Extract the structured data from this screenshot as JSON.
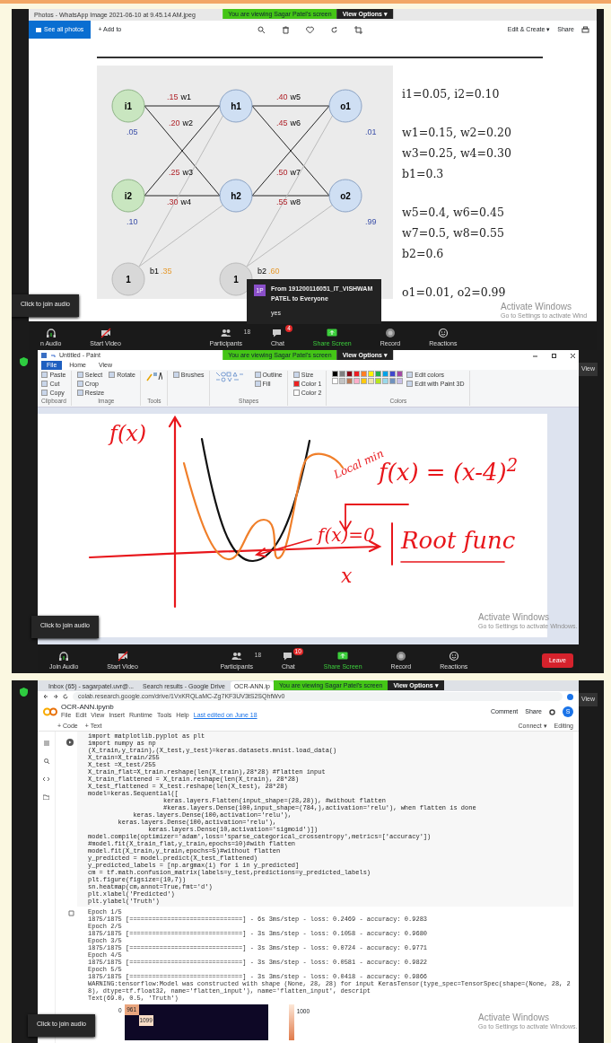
{
  "photos_share": {
    "viewing_banner": "You are viewing Sagar Patel's screen",
    "view_options": "View Options ▾",
    "window_title": "Photos - WhatsApp Image 2021-06-10 at 9.45.14 AM.jpeg",
    "see_all": "See all photos",
    "add_to": "+ Add to",
    "edit_create": "Edit & Create ▾",
    "share": "Share",
    "diagram": {
      "inputs": [
        {
          "label": "i1",
          "value": ".05"
        },
        {
          "label": "i2",
          "value": ".10"
        }
      ],
      "hidden": [
        {
          "label": "h1"
        },
        {
          "label": "h2"
        }
      ],
      "outputs": [
        {
          "label": "o1",
          "value": ".01"
        },
        {
          "label": "o2",
          "value": ".99"
        }
      ],
      "weights": [
        {
          "value": ".15",
          "name": "w1"
        },
        {
          "value": ".20",
          "name": "w2"
        },
        {
          "value": ".25",
          "name": "w3"
        },
        {
          "value": ".30",
          "name": "w4"
        },
        {
          "value": ".40",
          "name": "w5"
        },
        {
          "value": ".45",
          "name": "w6"
        },
        {
          "value": ".50",
          "name": "w7"
        },
        {
          "value": ".55",
          "name": "w8"
        }
      ],
      "biases": [
        {
          "node": "1",
          "name": "b1",
          "value": ".35"
        },
        {
          "node": "1",
          "name": "b2",
          "value": ".60"
        }
      ]
    },
    "equation_groups": [
      [
        "i1=0.05, i2=0.10"
      ],
      [
        "w1=0.15, w2=0.20",
        "w3=0.25, w4=0.30",
        "b1=0.3"
      ],
      [
        "w5=0.4, w6=0.45",
        "w7=0.5, w8=0.55",
        "b2=0.6"
      ],
      [
        "o1=0.01, o2=0.99"
      ]
    ],
    "chat_popup": {
      "avatar": "1P",
      "from": "From 191200116051_IT_VISHWAM PATEL to Everyone",
      "message": "yes"
    },
    "audio_tooltip": "Click to join audio",
    "activate": {
      "title": "Activate Windows",
      "hint": "Go to Settings to activate Wind"
    },
    "toolbar": [
      {
        "kind": "audio",
        "label": "n Audio"
      },
      {
        "kind": "video",
        "label": "Start Video"
      },
      {
        "kind": "participants",
        "label": "Participants",
        "count": "18"
      },
      {
        "kind": "chat",
        "label": "Chat",
        "badge": "4"
      },
      {
        "kind": "share",
        "label": "Share Screen"
      },
      {
        "kind": "record",
        "label": "Record"
      },
      {
        "kind": "reactions",
        "label": "Reactions"
      }
    ]
  },
  "paint_share": {
    "viewing_banner": "You are viewing Sagar Patel's screen",
    "view_options": "View Options ▾",
    "view_button": "View",
    "window_title": "Untitled - Paint",
    "tabs": [
      {
        "label": "File",
        "selected": true
      },
      {
        "label": "Home",
        "selected": false
      },
      {
        "label": "View",
        "selected": false
      }
    ],
    "groups": [
      {
        "label": "Clipboard",
        "tools": [
          "Paste",
          "Cut",
          "Copy"
        ]
      },
      {
        "label": "Image",
        "tools": [
          "Select",
          "Crop",
          "Resize",
          "Rotate"
        ]
      },
      {
        "label": "Tools"
      },
      {
        "tools": [
          "Brushes"
        ]
      },
      {
        "label": "Shapes",
        "tools": [
          "Outline",
          "Fill"
        ]
      },
      {
        "tools": [
          "Size",
          "Color 1",
          "Color 2"
        ]
      },
      {
        "label": "Colors",
        "tools": [
          "Edit colors",
          "Edit with Paint 3D"
        ]
      }
    ],
    "palette": [
      {
        "color": "#000000"
      },
      {
        "color": "#7f7f7f"
      },
      {
        "color": "#880015"
      },
      {
        "color": "#ed1c24"
      },
      {
        "color": "#ff7f27"
      },
      {
        "color": "#fff200"
      },
      {
        "color": "#22b14c"
      },
      {
        "color": "#00a2e8"
      },
      {
        "color": "#3f48cc"
      },
      {
        "color": "#a349a4"
      },
      {
        "color": "#ffffff"
      },
      {
        "color": "#c3c3c3"
      },
      {
        "color": "#b97a57"
      },
      {
        "color": "#ffaec9"
      },
      {
        "color": "#ffc90e"
      },
      {
        "color": "#efe4b0"
      },
      {
        "color": "#b5e61d"
      },
      {
        "color": "#99d9ea"
      },
      {
        "color": "#7092be"
      },
      {
        "color": "#c8bfe7"
      }
    ],
    "handwriting": {
      "y_label": "f(x)",
      "local_min": "Local min",
      "function": "f(x) = (x-4)$^{2}$",
      "root_eq": "f(x)=0",
      "root_label": "Root func",
      "x_label": "x"
    },
    "audio_tooltip": "Click to join audio",
    "activate": {
      "title": "Activate Windows",
      "hint": "Go to Settings to activate Windows."
    },
    "toolbar": [
      {
        "kind": "audio",
        "label": "Join Audio"
      },
      {
        "kind": "video",
        "label": "Start Video"
      },
      {
        "kind": "participants",
        "label": "Participants",
        "count": "18"
      },
      {
        "kind": "chat",
        "label": "Chat",
        "badge": "10"
      },
      {
        "kind": "share",
        "label": "Share Screen"
      },
      {
        "kind": "record",
        "label": "Record"
      },
      {
        "kind": "reactions",
        "label": "Reactions"
      },
      {
        "kind": "leave",
        "label": "Leave"
      }
    ]
  },
  "colab_share": {
    "viewing_banner": "You are viewing Sagar Patel's screen",
    "view_options": "View Options ▾",
    "view_button": "View",
    "browser_tabs": [
      {
        "label": "Inbox (65) - sagarpatel.uvr@...",
        "selected": false
      },
      {
        "label": "Search results - Google Drive",
        "selected": false
      },
      {
        "label": "OCR-ANN.ip",
        "selected": true
      }
    ],
    "url": "colab.research.google.com/drive/1VxKRQLaMC-Zg7KF3UV3tS2SQhfWv0",
    "notebook_title": "OCR-ANN.ipynb",
    "menu": [
      "File",
      "Edit",
      "View",
      "Insert",
      "Runtime",
      "Tools",
      "Help"
    ],
    "last_edited": "Last edited on June 18",
    "comment": "Comment",
    "share": "Share",
    "avatar": "S",
    "add_code": "+ Code",
    "add_text": "+ Text",
    "connect": "Connect ▾",
    "editing": "Editing",
    "code": [
      "import matplotlib.pyplot as plt",
      "import numpy as np",
      "(X_train,y_train),(X_test,y_test)=keras.datasets.mnist.load_data()",
      "X_train=X_train/255",
      "X_test =X_test/255",
      "X_train_flat=X_train.reshape(len(X_train),28*28) #flatten input",
      "X_train_flattened = X_train.reshape(len(X_train), 28*28)",
      "X_test_flattened = X_test.reshape(len(X_test), 28*28)",
      "model=keras.Sequential([",
      "                    keras.layers.Flatten(input_shape=(28,28)), #without flatten",
      "                    #keras.layers.Dense(100,input_shape=(784,),activation='relu'), when flatten is done",
      "            keras.layers.Dense(100,activation='relu'),",
      "        keras.layers.Dense(100,activation='relu'),",
      "                keras.layers.Dense(10,activation='sigmoid')])",
      "model.compile(optimizer='adam',loss='sparse_categorical_crossentropy',metrics=['accuracy'])",
      "#model.fit(X_train_flat,y_train,epochs=10)#with flatten",
      "model.fit(X_train,y_train,epochs=5)#without flatten",
      "y_predicted = model.predict(X_test_flattened)",
      "y_predicted_labels = [np.argmax(i) for i in y_predicted]",
      "cm = tf.math.confusion_matrix(labels=y_test,predictions=y_predicted_labels)",
      "plt.figure(figsize=(10,7))",
      "sn.heatmap(cm,annot=True,fmt='d')",
      "plt.xlabel('Predicted')",
      "plt.ylabel('Truth')"
    ],
    "output": [
      "Epoch 1/5",
      "1875/1875 [==============================] - 6s 3ms/step - loss: 0.2469 - accuracy: 0.9283",
      "Epoch 2/5",
      "1875/1875 [==============================] - 3s 3ms/step - loss: 0.1058 - accuracy: 0.9680",
      "Epoch 3/5",
      "1875/1875 [==============================] - 3s 3ms/step - loss: 0.0724 - accuracy: 0.9771",
      "Epoch 4/5",
      "1875/1875 [==============================] - 3s 3ms/step - loss: 0.0581 - accuracy: 0.9822",
      "Epoch 5/5",
      "1875/1875 [==============================] - 3s 3ms/step - loss: 0.0418 - accuracy: 0.9866",
      "WARNING:tensorflow:Model was constructed with shape (None, 28, 28) for input KerasTensor(type_spec=TensorSpec(shape=(None, 28, 28), dtype=tf.float32, name='flatten_input'), name='flatten_input', descript",
      "Text(69.0, 0.5, 'Truth')"
    ],
    "heatmap": {
      "row_label": "0",
      "first_cell": "961",
      "second_cell": "1099",
      "colorbar_tick": "1000"
    },
    "audio_tooltip": "Click to join audio",
    "activate": {
      "title": "Activate Windows",
      "hint": "Go to Settings to activate Windows."
    }
  }
}
